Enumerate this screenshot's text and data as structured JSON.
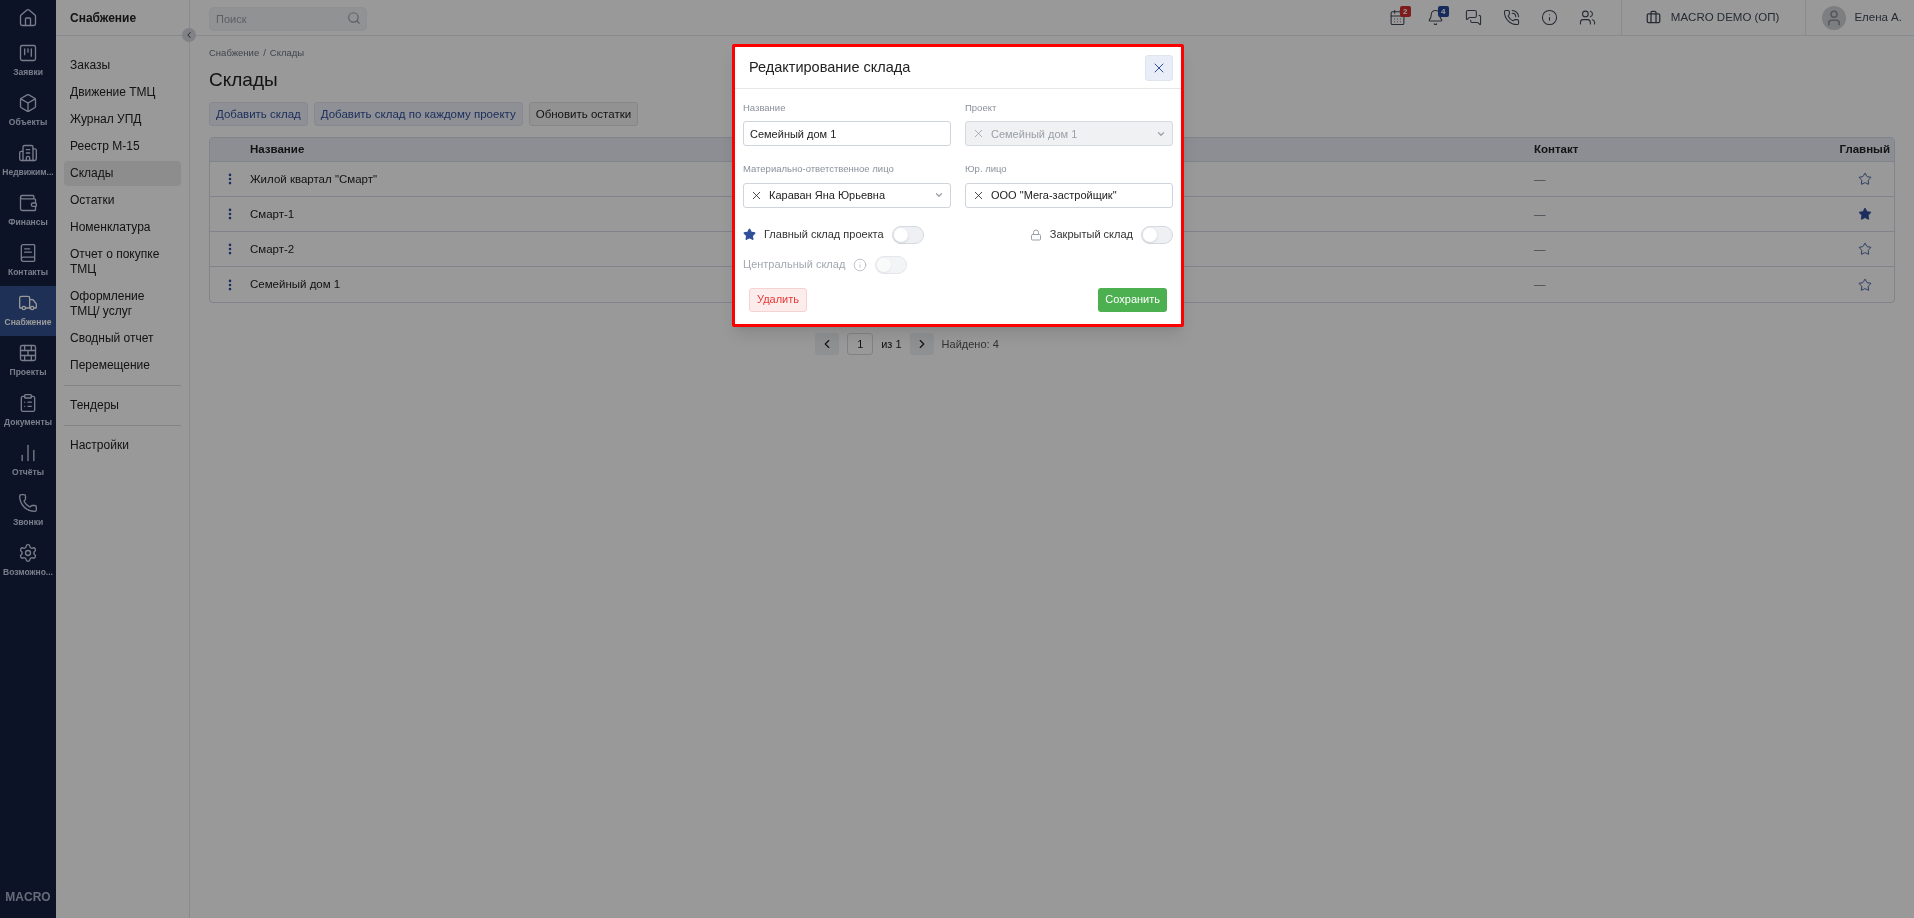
{
  "rail": {
    "items": [
      {
        "selected": false
      },
      {
        "label": "Заявки",
        "selected": false
      },
      {
        "label": "Объекты",
        "selected": false
      },
      {
        "label": "Недвижим...",
        "selected": false
      },
      {
        "label": "Финансы",
        "selected": false
      },
      {
        "label": "Контакты",
        "selected": false
      },
      {
        "label": "Снабжение",
        "selected": true
      },
      {
        "label": "Проекты",
        "selected": false
      },
      {
        "label": "Документы",
        "selected": false
      },
      {
        "label": "Отчёты",
        "selected": false
      },
      {
        "label": "Звонки",
        "selected": false
      },
      {
        "label": "Возможно...",
        "selected": false
      }
    ],
    "brand": "MACRO"
  },
  "submenu": {
    "title": "Снабжение",
    "groups": [
      [
        {
          "label": "Заказы",
          "selected": false
        },
        {
          "label": "Движение ТМЦ",
          "selected": false
        },
        {
          "label": "Журнал УПД",
          "selected": false
        },
        {
          "label": "Реестр М-15",
          "selected": false
        },
        {
          "label": "Склады",
          "selected": true
        },
        {
          "label": "Остатки",
          "selected": false
        },
        {
          "label": "Номенклатура",
          "selected": false
        },
        {
          "label": "Отчет о покупке ТМЦ",
          "selected": false
        },
        {
          "label": "Оформление ТМЦ/ услуг",
          "selected": false
        },
        {
          "label": "Сводный отчет",
          "selected": false
        },
        {
          "label": "Перемещение",
          "selected": false
        }
      ],
      [
        {
          "label": "Тендеры",
          "selected": false
        }
      ],
      [
        {
          "label": "Настройки",
          "selected": false
        }
      ]
    ]
  },
  "topbar": {
    "search": {
      "placeholder": "Поиск"
    },
    "icons": [
      {
        "kind": "calendar",
        "badge": "2"
      },
      {
        "kind": "bell",
        "badge": "4"
      },
      {
        "kind": "chat"
      },
      {
        "kind": "phone"
      },
      {
        "kind": "info"
      },
      {
        "kind": "users"
      }
    ],
    "company": "MACRO DEMO (ОП)",
    "user": "Елена А."
  },
  "breadcrumb": {
    "items": [
      "Снабжение",
      "Склады"
    ],
    "separator": "/"
  },
  "title": "Склады",
  "actions": [
    {
      "label": "Добавить склад",
      "kind": "accent"
    },
    {
      "label": "Добавить склад по каждому проекту",
      "kind": "accent"
    },
    {
      "label": "Обновить остатки",
      "kind": "plain"
    }
  ],
  "table": {
    "columns": [
      "Название",
      "Контакт",
      "Главный"
    ],
    "rows": [
      {
        "name": "Жилой квартал \"Смарт\"",
        "contact": "—",
        "main": false
      },
      {
        "name": "Смарт-1",
        "contact": "—",
        "main": true
      },
      {
        "name": "Смарт-2",
        "contact": "—",
        "main": false
      },
      {
        "name": "Семейный дом 1",
        "contact": "—",
        "main": false
      }
    ]
  },
  "pagination": {
    "page": "1",
    "of": "из 1",
    "found": "Найдено: 4"
  },
  "modal": {
    "title": "Редактирование склада",
    "fields": [
      {
        "label": "Название",
        "value": "Семейный дом 1",
        "kind": "text",
        "disabled": false
      },
      {
        "label": "Проект",
        "value": "Семейный дом 1",
        "kind": "select",
        "disabled": true
      },
      {
        "label": "Материально-ответственное лицо",
        "value": "Караван Яна Юрьевна",
        "kind": "select",
        "disabled": false
      },
      {
        "label": "Юр. лицо",
        "value": "ООО \"Мега-застройщик\"",
        "kind": "tag",
        "disabled": false
      }
    ],
    "toggles": [
      {
        "label": "Главный склад проекта",
        "kind": "star",
        "on": false,
        "disabled": false
      },
      {
        "label": "Закрытый склад",
        "kind": "lock",
        "on": false,
        "disabled": false
      },
      {
        "label": "Центральный склад",
        "kind": "info",
        "on": false,
        "disabled": true
      }
    ],
    "delete": "Удалить",
    "save": "Сохранить"
  }
}
